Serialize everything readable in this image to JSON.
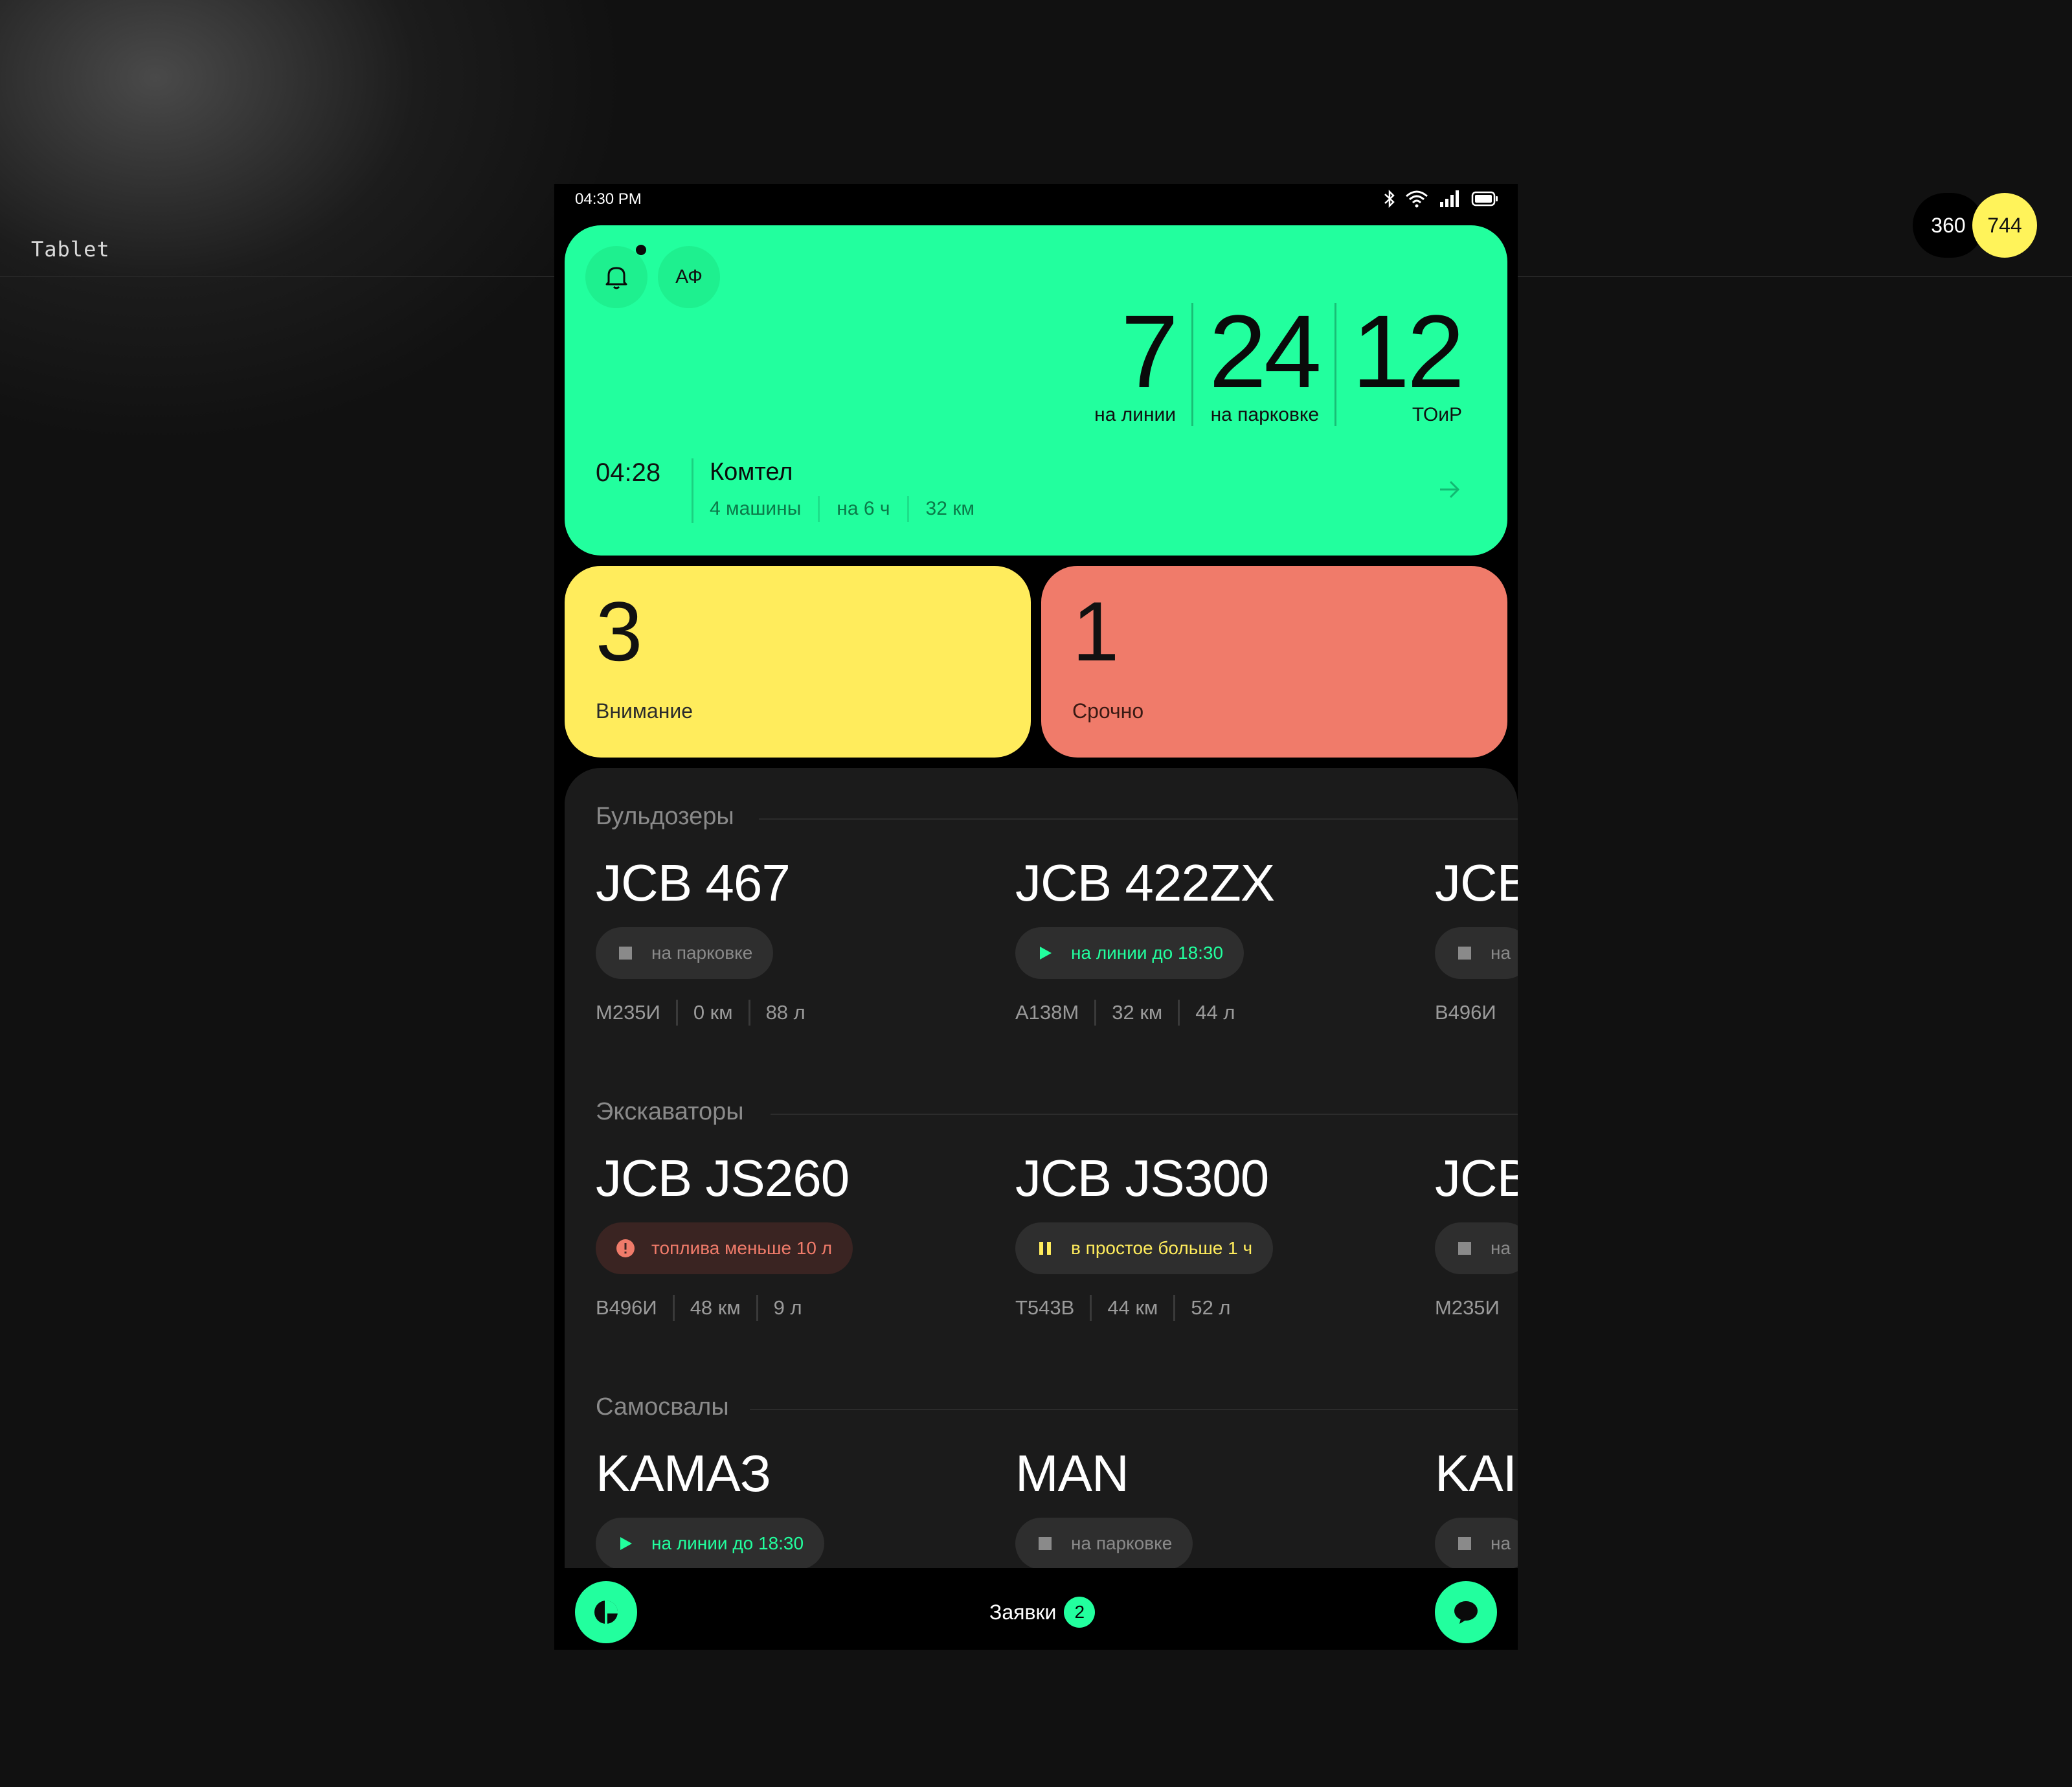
{
  "canvas": {
    "frame_label": "Tablet",
    "size_width": "360",
    "size_height": "744"
  },
  "statusbar": {
    "time": "04:30 PM",
    "icons": [
      "bluetooth-icon",
      "wifi-icon",
      "signal-icon",
      "battery-icon"
    ]
  },
  "hero": {
    "initials": "АФ",
    "has_unread_notifications": true,
    "stats": [
      {
        "value": "7",
        "label": "на линии"
      },
      {
        "value": "24",
        "label": "на парковке"
      },
      {
        "value": "12",
        "label": "ТОиР"
      }
    ],
    "trip": {
      "time": "04:28",
      "company": "Комтел",
      "meta": [
        "4 машины",
        "на 6 ч",
        "32 км"
      ]
    }
  },
  "alerts": {
    "attention": {
      "count": "3",
      "label": "Внимание"
    },
    "urgent": {
      "count": "1",
      "label": "Срочно"
    }
  },
  "groups": [
    {
      "title": "Бульдозеры",
      "machines": [
        {
          "name": "JCB 467",
          "status": "на парковке",
          "status_type": "parking",
          "plate": "М235И",
          "distance": "0 км",
          "fuel": "88 л"
        },
        {
          "name": "JCB 422ZX",
          "status": "на линии до 18:30",
          "status_type": "online",
          "plate": "А138М",
          "distance": "32 км",
          "fuel": "44 л"
        },
        {
          "name": "JCB",
          "status": "на",
          "status_type": "parking",
          "plate": "В496И",
          "distance": "",
          "fuel": ""
        }
      ]
    },
    {
      "title": "Экскаваторы",
      "machines": [
        {
          "name": "JCB JS260",
          "status": "топлива меньше 10 л",
          "status_type": "fuel",
          "plate": "В496И",
          "distance": "48 км",
          "fuel": "9 л"
        },
        {
          "name": "JCB JS300",
          "status": "в простое больше 1 ч",
          "status_type": "idle",
          "plate": "Т543В",
          "distance": "44 км",
          "fuel": "52 л"
        },
        {
          "name": "JCB",
          "status": "на",
          "status_type": "parking",
          "plate": "М235И",
          "distance": "",
          "fuel": ""
        }
      ]
    },
    {
      "title": "Самосвалы",
      "machines": [
        {
          "name": "KAMAЗ",
          "status": "на линии до 18:30",
          "status_type": "online",
          "plate": "",
          "distance": "",
          "fuel": ""
        },
        {
          "name": "MAN",
          "status": "на парковке",
          "status_type": "parking",
          "plate": "",
          "distance": "",
          "fuel": ""
        },
        {
          "name": "KAI",
          "status": "на",
          "status_type": "parking",
          "plate": "",
          "distance": "",
          "fuel": ""
        }
      ]
    }
  ],
  "bottombar": {
    "tab_label": "Заявки",
    "tab_badge": "2",
    "left_icon": "pie-chart-icon",
    "right_icon": "chat-icon"
  },
  "colors": {
    "accent_green": "#22ff9e",
    "attention_yellow": "#ffec5c",
    "urgent_red": "#f07b6a",
    "panel": "#1b1b1b"
  }
}
